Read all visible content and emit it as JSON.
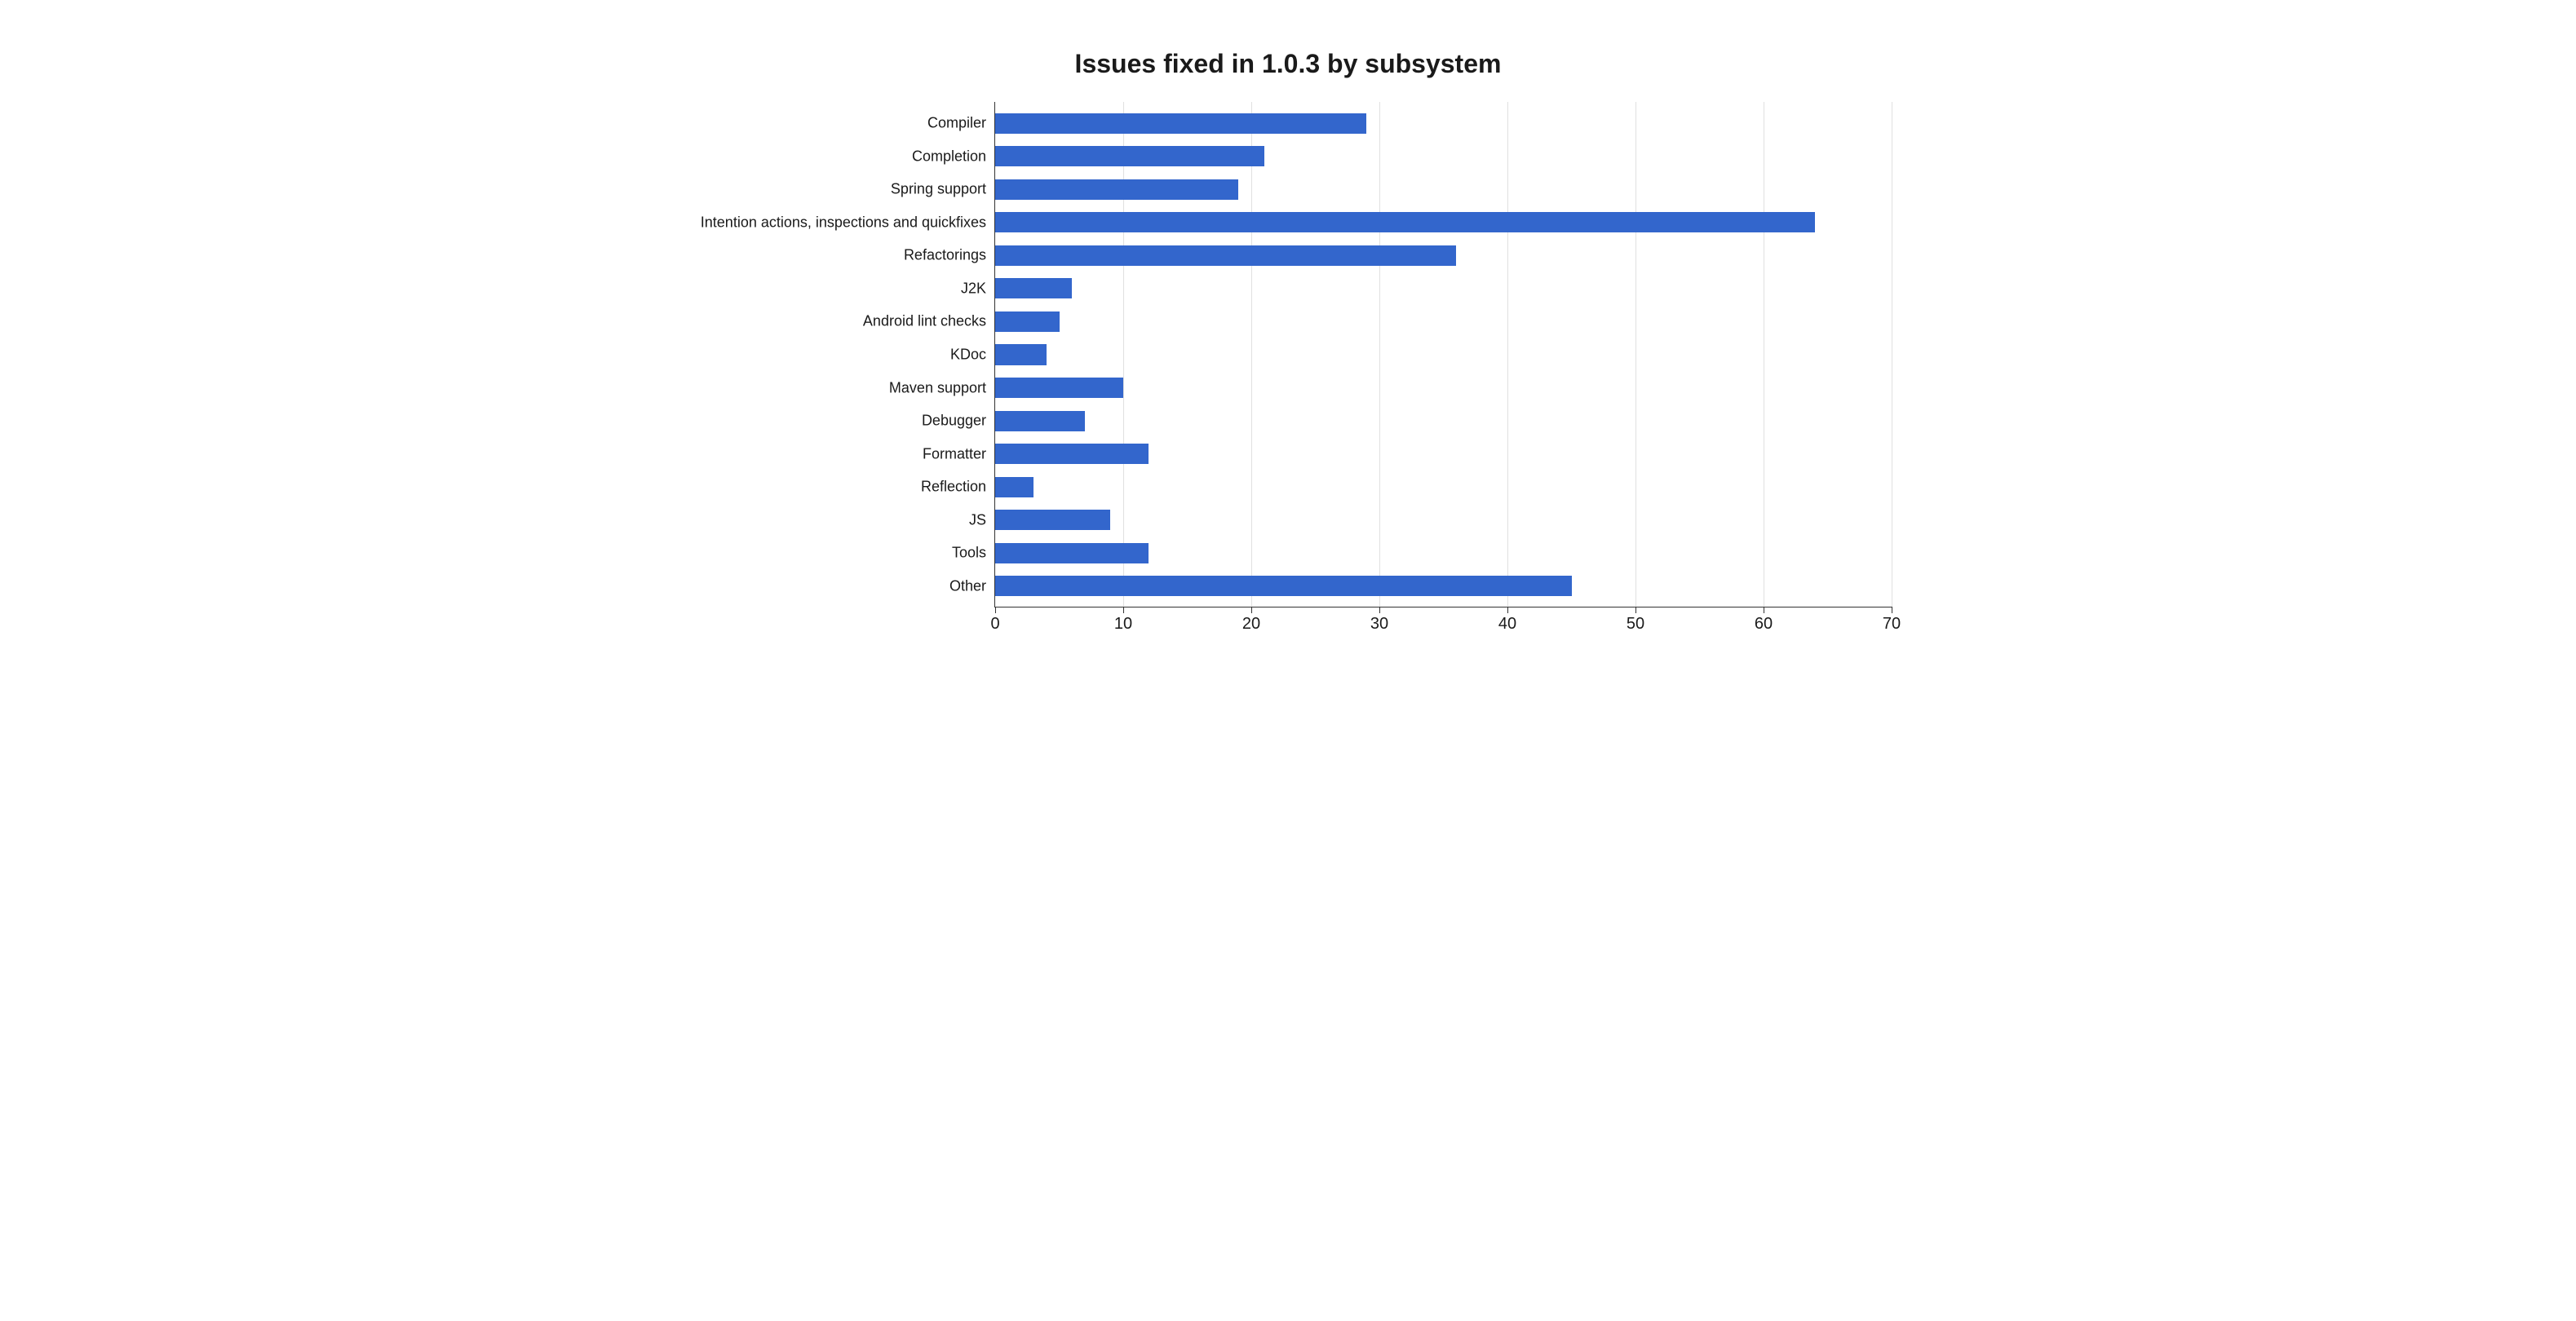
{
  "chart_data": {
    "type": "bar",
    "orientation": "horizontal",
    "title": "Issues fixed in 1.0.3 by subsystem",
    "xlabel": "",
    "ylabel": "",
    "xlim": [
      0,
      70
    ],
    "x_ticks": [
      0,
      10,
      20,
      30,
      40,
      50,
      60,
      70
    ],
    "categories": [
      "Compiler",
      "Completion",
      "Spring support",
      "Intention actions, inspections and quickfixes",
      "Refactorings",
      "J2K",
      "Android lint checks",
      "KDoc",
      "Maven support",
      "Debugger",
      "Formatter",
      "Reflection",
      "JS",
      "Tools",
      "Other"
    ],
    "values": [
      29,
      21,
      19,
      64,
      36,
      6,
      5,
      4,
      10,
      7,
      12,
      3,
      9,
      12,
      45
    ],
    "bar_color": "#3366cc"
  }
}
